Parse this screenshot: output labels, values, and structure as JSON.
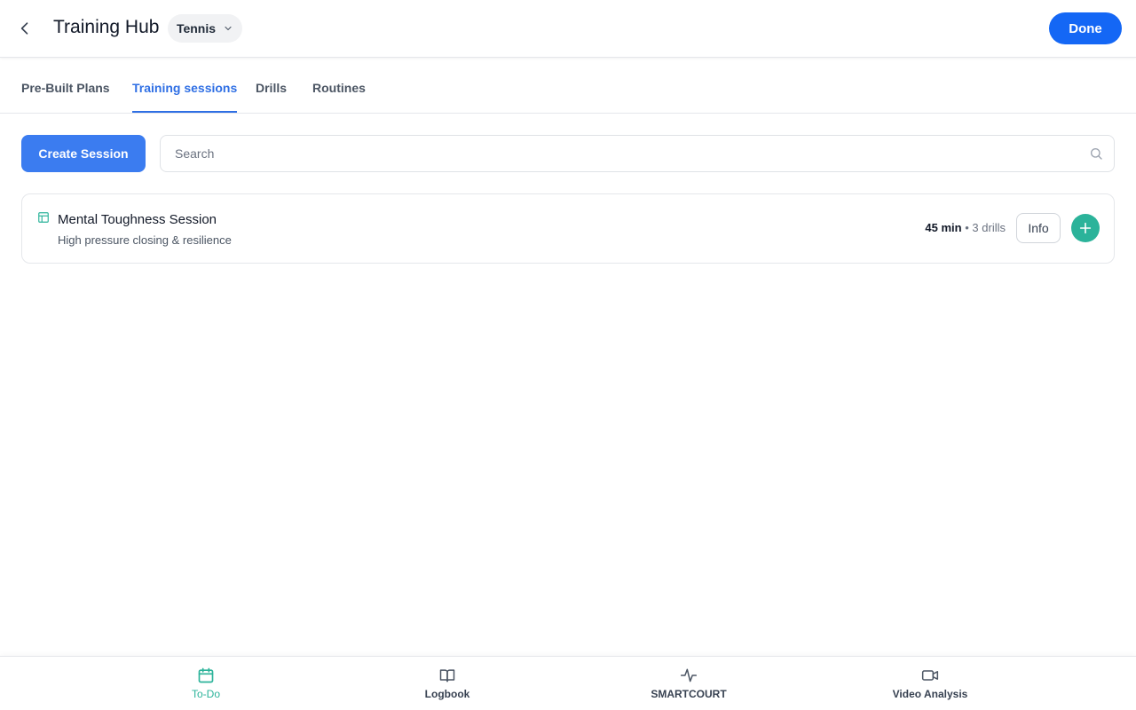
{
  "header": {
    "title": "Training Hub",
    "sport": "Tennis",
    "done_label": "Done"
  },
  "tabs": [
    {
      "label": "Pre-Built Plans",
      "active": false
    },
    {
      "label": "Training sessions",
      "active": true
    },
    {
      "label": "Drills",
      "active": false
    },
    {
      "label": "Routines",
      "active": false
    }
  ],
  "toolbar": {
    "create_label": "Create Session",
    "search_placeholder": "Search",
    "search_value": ""
  },
  "sessions": [
    {
      "title": "Mental Toughness Session",
      "subtitle": "High pressure closing & resilience",
      "duration": "45 min",
      "separator": "•",
      "drills": "3 drills",
      "info_label": "Info"
    }
  ],
  "bottom_nav": [
    {
      "label": "To-Do",
      "icon": "calendar-icon",
      "active": true
    },
    {
      "label": "Logbook",
      "icon": "book-icon",
      "active": false
    },
    {
      "label": "SMARTCOURT",
      "icon": "activity-icon",
      "active": false
    },
    {
      "label": "Video Analysis",
      "icon": "video-icon",
      "active": false
    }
  ],
  "colors": {
    "primary": "#1467f5",
    "create_button": "#3b7cf0",
    "active_tab": "#2f6fe4",
    "accent_green": "#2bb39a"
  }
}
